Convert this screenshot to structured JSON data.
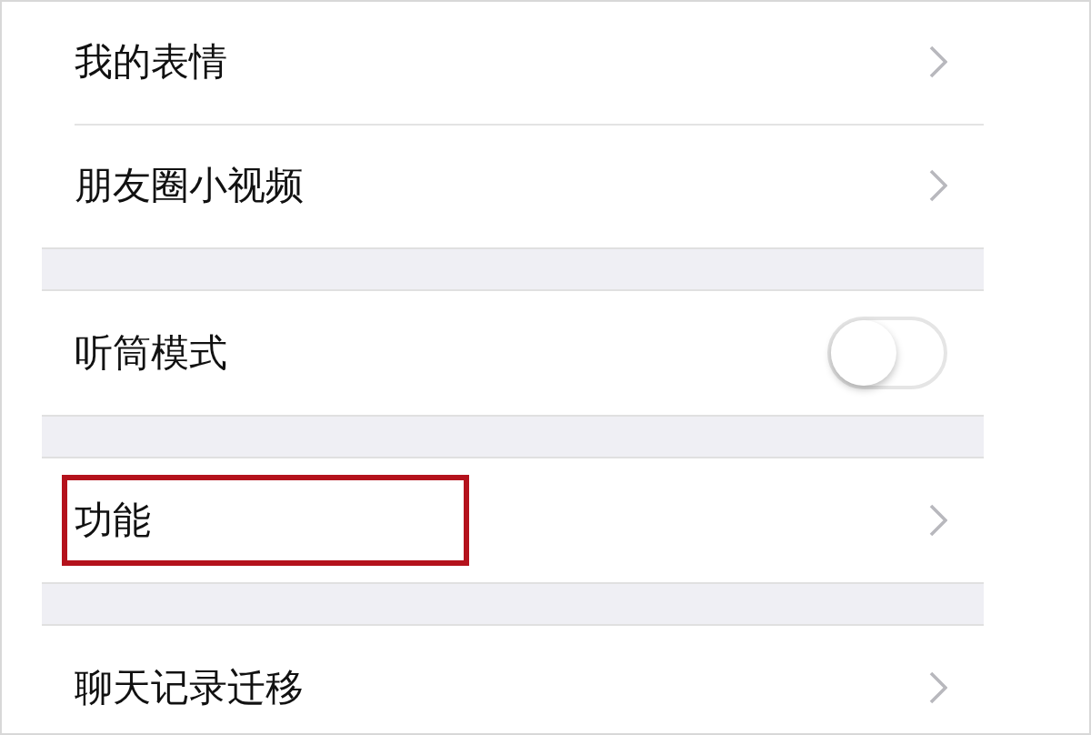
{
  "groups": [
    {
      "items": [
        {
          "kind": "link",
          "label": "我的表情",
          "highlighted": false
        },
        {
          "kind": "link",
          "label": "朋友圈小视频",
          "highlighted": false
        }
      ]
    },
    {
      "items": [
        {
          "kind": "toggle",
          "label": "听筒模式",
          "on": false,
          "highlighted": false
        }
      ]
    },
    {
      "items": [
        {
          "kind": "link",
          "label": "功能",
          "highlighted": true
        }
      ]
    },
    {
      "items": [
        {
          "kind": "link",
          "label": "聊天记录迁移",
          "highlighted": false
        }
      ]
    }
  ]
}
